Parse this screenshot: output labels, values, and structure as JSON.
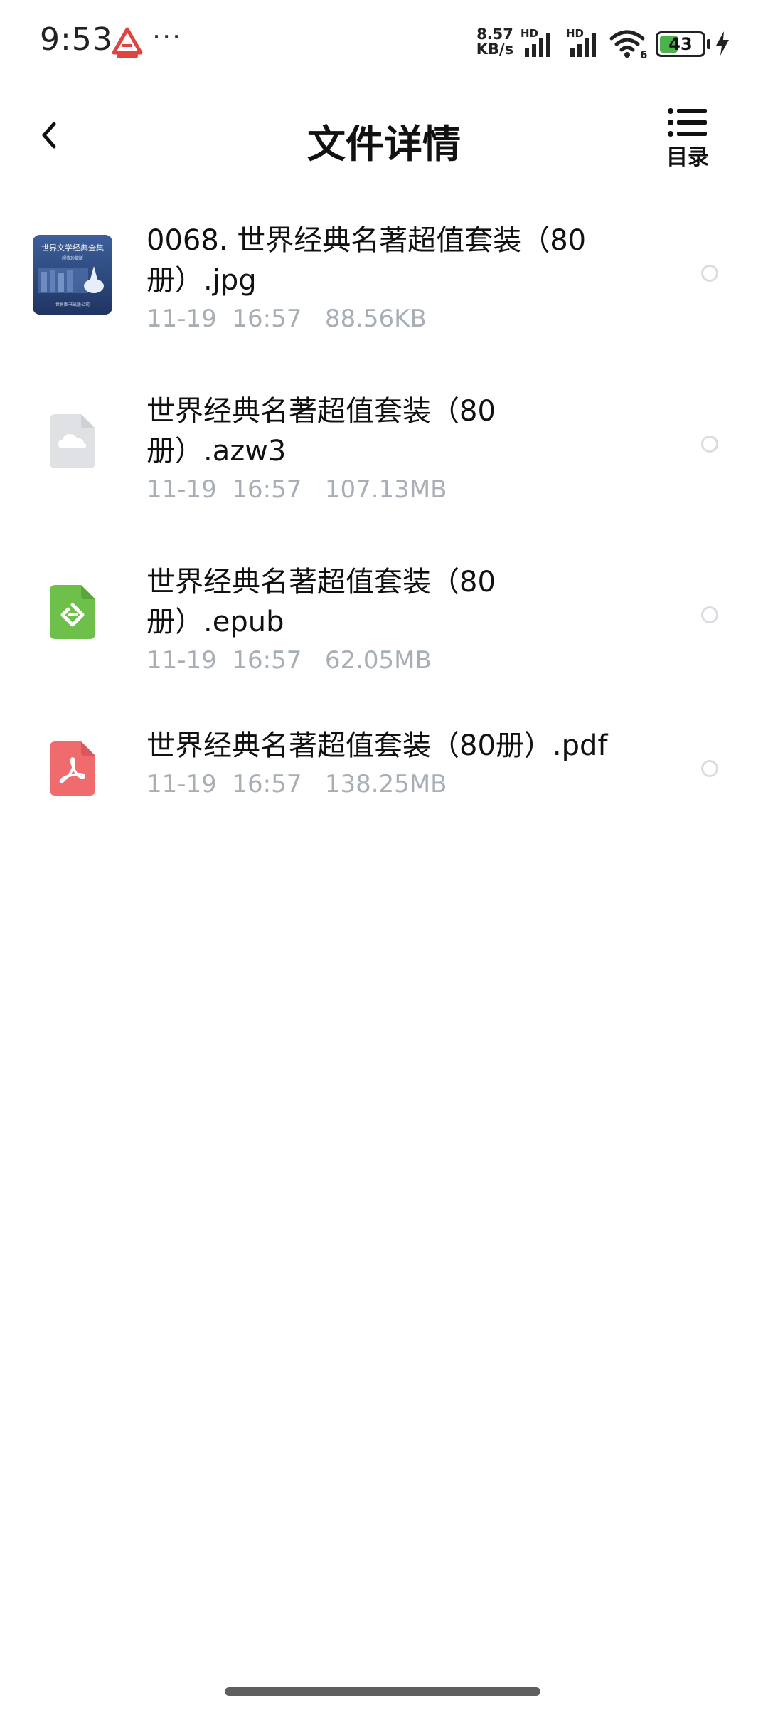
{
  "status_bar": {
    "time": "9:53",
    "more": "···",
    "net_speed_value": "8.57",
    "net_speed_unit": "KB/s",
    "signal_1_label": "HD",
    "signal_2_label": "HD",
    "wifi_label": "6",
    "battery_level": "43",
    "battery_fraction": 0.43,
    "battery_color": "#4cb34c"
  },
  "header": {
    "title": "文件详情",
    "toc_label": "目录"
  },
  "files": [
    {
      "name": "0068. 世界经典名著超值套装（80册）.jpg",
      "date": "11-19",
      "time": "16:57",
      "size": "88.56KB",
      "thumbnail": {
        "title": "世界文学经典全集",
        "subtitle": "超值珍藏版",
        "footer": "世界图书出版公司"
      }
    },
    {
      "name": "世界经典名著超值套装（80册）.azw3",
      "date": "11-19",
      "time": "16:57",
      "size": "107.13MB",
      "icon": "cloud-file-icon"
    },
    {
      "name": "世界经典名著超值套装（80册）.epub",
      "date": "11-19",
      "time": "16:57",
      "size": "62.05MB",
      "icon": "epub-file-icon"
    },
    {
      "name": "世界经典名著超值套装（80册）.pdf",
      "date": "11-19",
      "time": "16:57",
      "size": "138.25MB",
      "icon": "pdf-file-icon"
    }
  ],
  "colors": {
    "meta_text": "#a8aeb6",
    "epub_green": "#6fbf4b",
    "pdf_red": "#f06b6e",
    "cloud_gray": "#dfe1e4",
    "thumb_blue": "#2f4f86"
  }
}
